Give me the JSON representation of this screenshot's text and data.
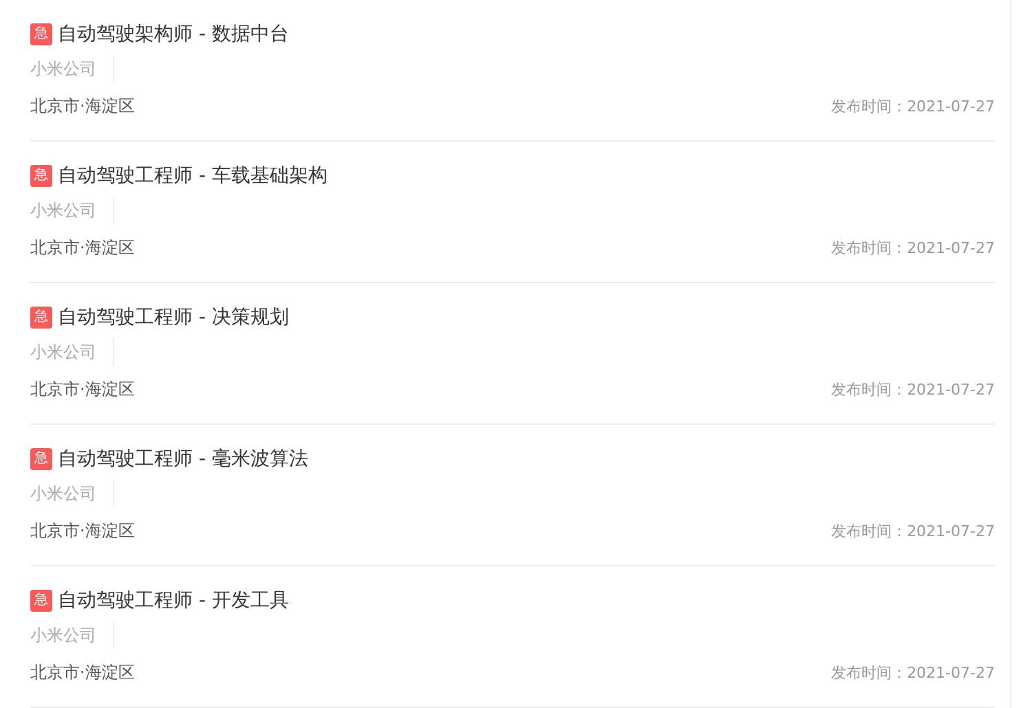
{
  "jobs": [
    {
      "badge": "急",
      "title": "自动驾驶架构师 - 数据中台",
      "company": "小米公司",
      "location": "北京市·海淀区",
      "date": "发布时间：2021-07-27"
    },
    {
      "badge": "急",
      "title": "自动驾驶工程师 - 车载基础架构",
      "company": "小米公司",
      "location": "北京市·海淀区",
      "date": "发布时间：2021-07-27"
    },
    {
      "badge": "急",
      "title": "自动驾驶工程师 - 决策规划",
      "company": "小米公司",
      "location": "北京市·海淀区",
      "date": "发布时间：2021-07-27"
    },
    {
      "badge": "急",
      "title": "自动驾驶工程师 - 毫米波算法",
      "company": "小米公司",
      "location": "北京市·海淀区",
      "date": "发布时间：2021-07-27"
    },
    {
      "badge": "急",
      "title": "自动驾驶工程师 - 开发工具",
      "company": "小米公司",
      "location": "北京市·海淀区",
      "date": "发布时间：2021-07-27"
    }
  ]
}
